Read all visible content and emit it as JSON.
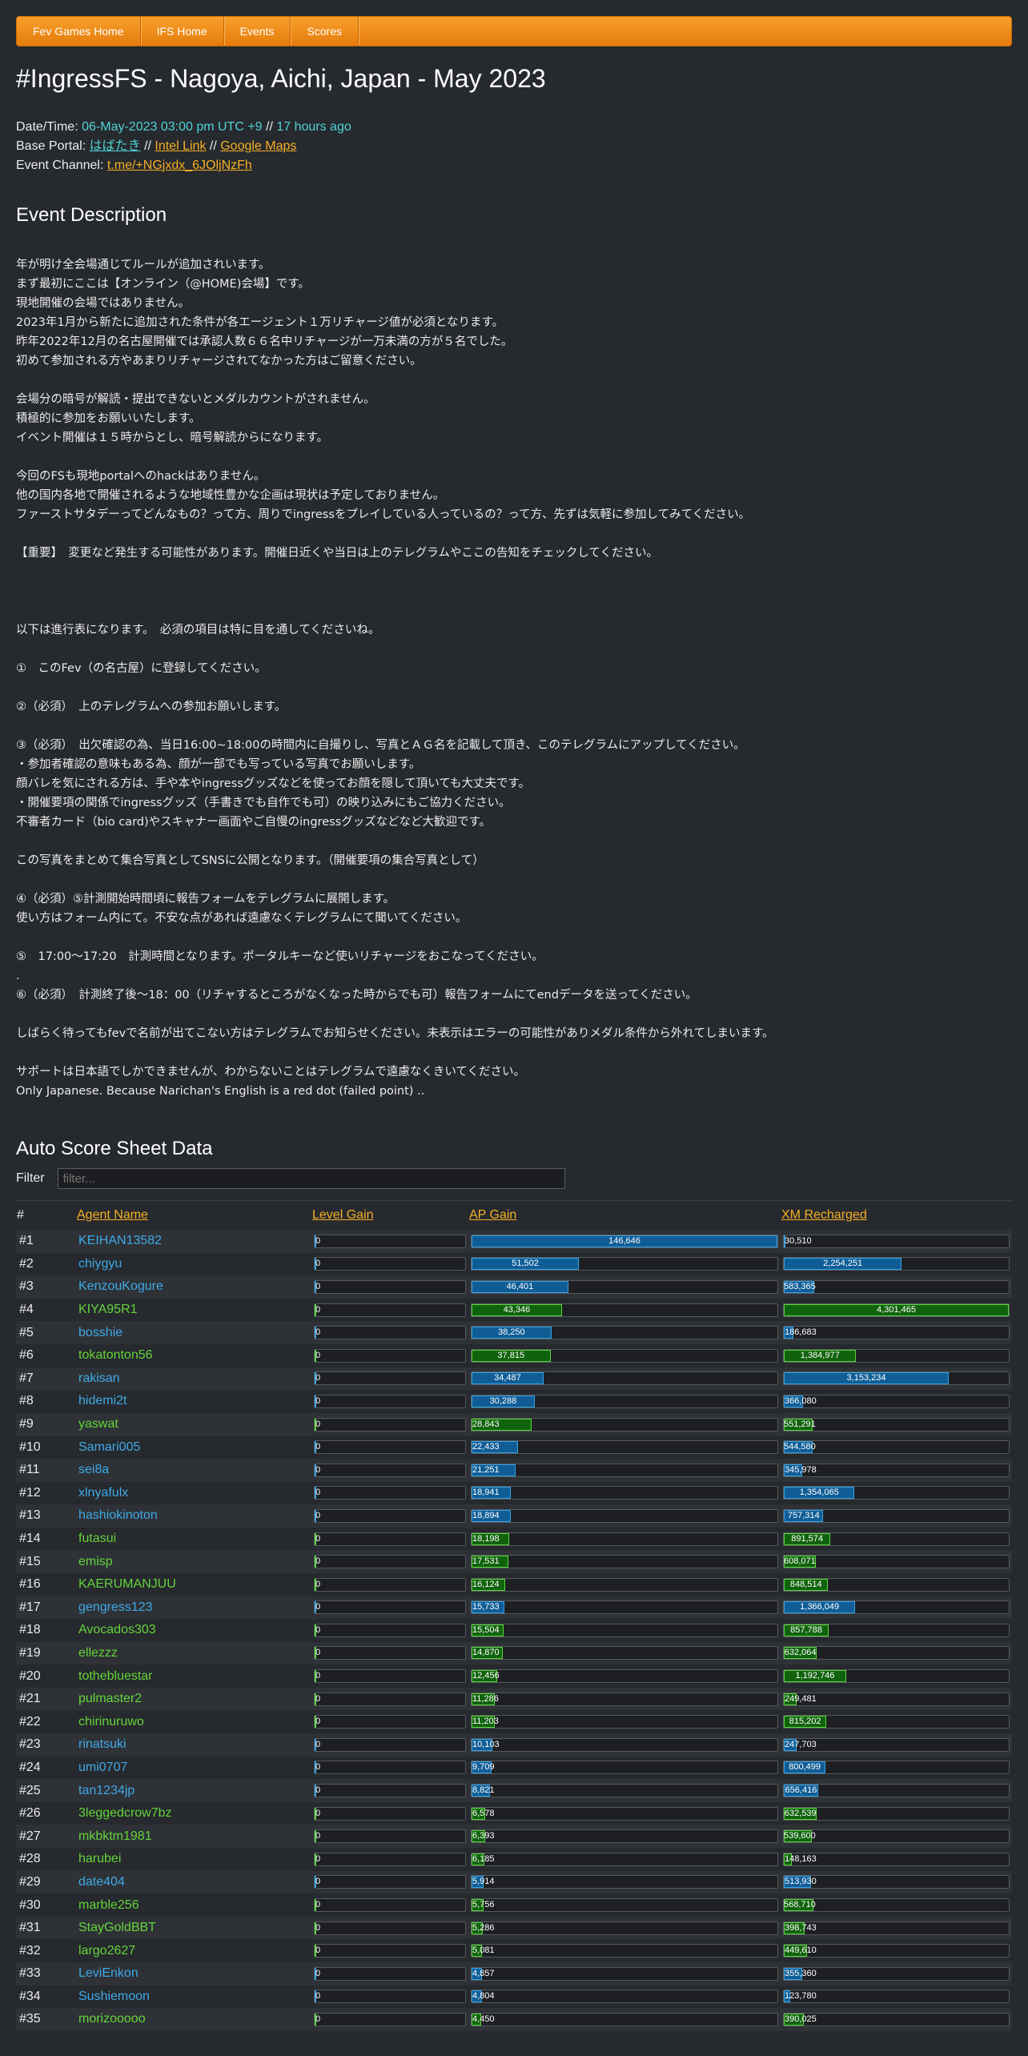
{
  "nav": [
    "Fev Games Home",
    "IFS Home",
    "Events",
    "Scores"
  ],
  "title": "#IngressFS - Nagoya, Aichi, Japan - May 2023",
  "meta": {
    "datetime_label": "Date/Time:",
    "datetime_value": "06-May-2023 03:00 pm UTC +9",
    "datetime_sep": " // ",
    "datetime_ago": "17 hours ago",
    "portal_label": "Base Portal:",
    "portal_name": "はばたき",
    "sep": " // ",
    "intel_link": "Intel Link",
    "maps_link": "Google Maps",
    "channel_label": "Event Channel:",
    "channel_link": "t.me/+NGjxdx_6JOljNzFh"
  },
  "description_heading": "Event Description",
  "description": "年が明け全会場通じてルールが追加されいます。\nまず最初にここは【オンライン（@HOME)会場】です。\n現地開催の会場ではありません。\n2023年1月から新たに追加された条件が各エージェント１万リチャージ値が必須となります。\n昨年2022年12月の名古屋開催では承認人数６６名中リチャージが一万未満の方が５名でした。\n初めて参加される方やあまりリチャージされてなかった方はご留意ください。\n\n会場分の暗号が解読・提出できないとメダルカウントがされません。\n積極的に参加をお願いいたします。\nイベント開催は１５時からとし、暗号解読からになります。\n\n今回のFSも現地portalへのhackはありません。\n他の国内各地で開催されるような地域性豊かな企画は現状は予定しておりません。\nファーストサタデーってどんなもの？って方、周りでingressをプレイしている人っているの？って方、先ずは気軽に参加してみてください。\n\n【重要】　変更など発生する可能性があります。開催日近くや当日は上のテレグラムやここの告知をチェックしてください。\n\n\n\n以下は進行表になります。　必須の項目は特に目を通してくださいね。\n\n①　このFev（の名古屋）に登録してください。\n\n②（必須）　上のテレグラムへの参加お願いします。\n\n③（必須）　出欠確認の為、当日16:00~18:00の時間内に自撮りし、写真とＡＧ名を記載して頂き、このテレグラムにアップしてください。\n・参加者確認の意味もある為、顔が一部でも写っている写真でお願いします。\n顔バレを気にされる方は、手や本やingressグッズなどを使ってお顔を隠して頂いても大丈夫です。\n・開催要項の関係でingressグッズ（手書きでも自作でも可）の映り込みにもご協力ください。\n不審者カード（bio card)やスキャナー画面やご自慢のingressグッズなどなど大歓迎です。\n\nこの写真をまとめて集合写真としてSNSに公開となります。（開催要項の集合写真として）\n\n④（必須）⑤計測開始時間頃に報告フォームをテレグラムに展開します。\n使い方はフォーム内にて。不安な点があれば遠慮なくテレグラムにて聞いてください。\n\n⑤　17:00～17:20　計測時間となります。ポータルキーなど使いリチャージをおこなってください。\n.\n⑥（必須）　計測終了後～18：00（リチャするところがなくなった時からでも可）報告フォームにてendデータを送ってください。\n\nしばらく待ってもfevで名前が出てこない方はテレグラムでお知らせください。未表示はエラーの可能性がありメダル条件から外れてしまいます。\n\nサポートは日本語でしかできませんが、わからないことはテレグラムで遠慮なくきいてください。\nOnly Japanese. Because Narichan's English is a red dot (failed point) ..",
  "score": {
    "heading": "Auto Score Sheet Data",
    "filter_label": "Filter",
    "filter_placeholder": "filter...",
    "columns": [
      "#",
      "Agent Name",
      "Level Gain",
      "AP Gain",
      "XM Recharged"
    ],
    "ap_max": 146646,
    "xm_max": 4301465,
    "rows": [
      {
        "rank": "#1",
        "name": "KEIHAN13582",
        "team": "blue",
        "level": "0",
        "ap": "146,646",
        "ap_n": 146646,
        "xm": "30,510",
        "xm_n": 30510
      },
      {
        "rank": "#2",
        "name": "chiygyu",
        "team": "blue",
        "level": "0",
        "ap": "51,502",
        "ap_n": 51502,
        "xm": "2,254,251",
        "xm_n": 2254251
      },
      {
        "rank": "#3",
        "name": "KenzouKogure",
        "team": "blue",
        "level": "0",
        "ap": "46,401",
        "ap_n": 46401,
        "xm": "583,365",
        "xm_n": 583365
      },
      {
        "rank": "#4",
        "name": "KIYA95R1",
        "team": "green",
        "level": "0",
        "ap": "43,346",
        "ap_n": 43346,
        "xm": "4,301,465",
        "xm_n": 4301465
      },
      {
        "rank": "#5",
        "name": "bosshie",
        "team": "blue",
        "level": "0",
        "ap": "38,250",
        "ap_n": 38250,
        "xm": "186,683",
        "xm_n": 186683
      },
      {
        "rank": "#6",
        "name": "tokatonton56",
        "team": "green",
        "level": "0",
        "ap": "37,815",
        "ap_n": 37815,
        "xm": "1,384,977",
        "xm_n": 1384977
      },
      {
        "rank": "#7",
        "name": "rakisan",
        "team": "blue",
        "level": "0",
        "ap": "34,487",
        "ap_n": 34487,
        "xm": "3,153,234",
        "xm_n": 3153234
      },
      {
        "rank": "#8",
        "name": "hidemi2t",
        "team": "blue",
        "level": "0",
        "ap": "30,288",
        "ap_n": 30288,
        "xm": "366,080",
        "xm_n": 366080
      },
      {
        "rank": "#9",
        "name": "yaswat",
        "team": "green",
        "level": "0",
        "ap": "28,843",
        "ap_n": 28843,
        "xm": "551,291",
        "xm_n": 551291
      },
      {
        "rank": "#10",
        "name": "Samari005",
        "team": "blue",
        "level": "0",
        "ap": "22,433",
        "ap_n": 22433,
        "xm": "544,580",
        "xm_n": 544580
      },
      {
        "rank": "#11",
        "name": "sei8a",
        "team": "blue",
        "level": "0",
        "ap": "21,251",
        "ap_n": 21251,
        "xm": "345,978",
        "xm_n": 345978
      },
      {
        "rank": "#12",
        "name": "xlnyafulx",
        "team": "blue",
        "level": "0",
        "ap": "18,941",
        "ap_n": 18941,
        "xm": "1,354,065",
        "xm_n": 1354065
      },
      {
        "rank": "#13",
        "name": "hashiokinoton",
        "team": "blue",
        "level": "0",
        "ap": "18,894",
        "ap_n": 18894,
        "xm": "757,314",
        "xm_n": 757314
      },
      {
        "rank": "#14",
        "name": "futasui",
        "team": "green",
        "level": "0",
        "ap": "18,198",
        "ap_n": 18198,
        "xm": "891,574",
        "xm_n": 891574
      },
      {
        "rank": "#15",
        "name": "emisp",
        "team": "green",
        "level": "0",
        "ap": "17,531",
        "ap_n": 17531,
        "xm": "608,071",
        "xm_n": 608071
      },
      {
        "rank": "#16",
        "name": "KAERUMANJUU",
        "team": "green",
        "level": "0",
        "ap": "16,124",
        "ap_n": 16124,
        "xm": "848,514",
        "xm_n": 848514
      },
      {
        "rank": "#17",
        "name": "gengress123",
        "team": "blue",
        "level": "0",
        "ap": "15,733",
        "ap_n": 15733,
        "xm": "1,366,049",
        "xm_n": 1366049
      },
      {
        "rank": "#18",
        "name": "Avocados303",
        "team": "green",
        "level": "0",
        "ap": "15,504",
        "ap_n": 15504,
        "xm": "857,788",
        "xm_n": 857788
      },
      {
        "rank": "#19",
        "name": "ellezzz",
        "team": "green",
        "level": "0",
        "ap": "14,870",
        "ap_n": 14870,
        "xm": "632,064",
        "xm_n": 632064
      },
      {
        "rank": "#20",
        "name": "tothebluestar",
        "team": "green",
        "level": "0",
        "ap": "12,456",
        "ap_n": 12456,
        "xm": "1,192,746",
        "xm_n": 1192746
      },
      {
        "rank": "#21",
        "name": "pulmaster2",
        "team": "green",
        "level": "0",
        "ap": "11,286",
        "ap_n": 11286,
        "xm": "249,481",
        "xm_n": 249481
      },
      {
        "rank": "#22",
        "name": "chirinuruwo",
        "team": "green",
        "level": "0",
        "ap": "11,203",
        "ap_n": 11203,
        "xm": "815,202",
        "xm_n": 815202
      },
      {
        "rank": "#23",
        "name": "rinatsuki",
        "team": "blue",
        "level": "0",
        "ap": "10,103",
        "ap_n": 10103,
        "xm": "247,703",
        "xm_n": 247703
      },
      {
        "rank": "#24",
        "name": "umi0707",
        "team": "blue",
        "level": "0",
        "ap": "9,709",
        "ap_n": 9709,
        "xm": "800,499",
        "xm_n": 800499
      },
      {
        "rank": "#25",
        "name": "tan1234jp",
        "team": "blue",
        "level": "0",
        "ap": "8,821",
        "ap_n": 8821,
        "xm": "656,416",
        "xm_n": 656416
      },
      {
        "rank": "#26",
        "name": "3leggedcrow7bz",
        "team": "green",
        "level": "0",
        "ap": "6,578",
        "ap_n": 6578,
        "xm": "632,539",
        "xm_n": 632539
      },
      {
        "rank": "#27",
        "name": "mkbktm1981",
        "team": "green",
        "level": "0",
        "ap": "6,393",
        "ap_n": 6393,
        "xm": "539,600",
        "xm_n": 539600
      },
      {
        "rank": "#28",
        "name": "harubei",
        "team": "green",
        "level": "0",
        "ap": "6,185",
        "ap_n": 6185,
        "xm": "148,163",
        "xm_n": 148163
      },
      {
        "rank": "#29",
        "name": "date404",
        "team": "blue",
        "level": "0",
        "ap": "5,914",
        "ap_n": 5914,
        "xm": "513,930",
        "xm_n": 513930
      },
      {
        "rank": "#30",
        "name": "marble256",
        "team": "green",
        "level": "0",
        "ap": "5,756",
        "ap_n": 5756,
        "xm": "568,710",
        "xm_n": 568710
      },
      {
        "rank": "#31",
        "name": "StayGoldBBT",
        "team": "green",
        "level": "0",
        "ap": "5,286",
        "ap_n": 5286,
        "xm": "398,743",
        "xm_n": 398743
      },
      {
        "rank": "#32",
        "name": "largo2627",
        "team": "green",
        "level": "0",
        "ap": "5,081",
        "ap_n": 5081,
        "xm": "449,610",
        "xm_n": 449610
      },
      {
        "rank": "#33",
        "name": "LeviEnkon",
        "team": "blue",
        "level": "0",
        "ap": "4,857",
        "ap_n": 4857,
        "xm": "355,360",
        "xm_n": 355360
      },
      {
        "rank": "#34",
        "name": "Sushiemoon",
        "team": "blue",
        "level": "0",
        "ap": "4,804",
        "ap_n": 4804,
        "xm": "123,780",
        "xm_n": 123780
      },
      {
        "rank": "#35",
        "name": "morizooooo",
        "team": "green",
        "level": "0",
        "ap": "4,450",
        "ap_n": 4450,
        "xm": "390,025",
        "xm_n": 390025
      }
    ]
  },
  "colors": {
    "blue": "#3fa9e8",
    "green": "#64d43c",
    "accent": "#f5b026",
    "nav": "#f08f1c"
  }
}
